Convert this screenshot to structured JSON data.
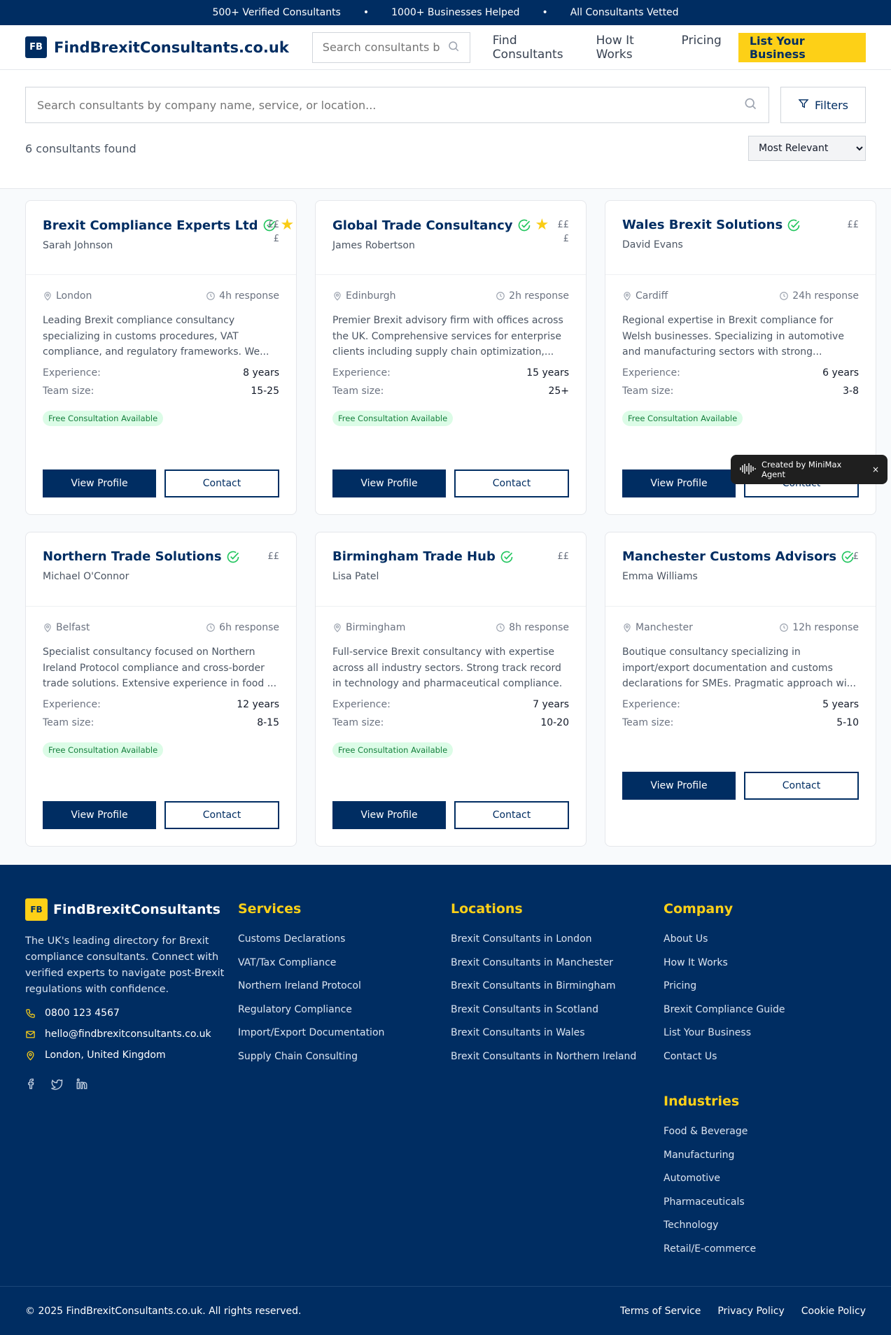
{
  "topbar": {
    "item1": "500+ Verified Consultants",
    "item2": "1000+ Businesses Helped",
    "item3": "All Consultants Vetted",
    "separator": "•"
  },
  "nav": {
    "logo_mark": "FB",
    "logo_text": "FindBrexitConsultants.co.uk",
    "search_placeholder": "Search consultants b",
    "links": [
      "Find Consultants",
      "How It Works",
      "Pricing"
    ],
    "cta": "List Your Business"
  },
  "search": {
    "placeholder": "Search consultants by company name, service, or location...",
    "filters_label": "Filters",
    "results_count": "6 consultants found",
    "sort_selected": "Most Relevant"
  },
  "consultants": [
    {
      "name": "Brexit Compliance Experts Ltd",
      "owner": "Sarah Johnson",
      "featured": true,
      "price": "£££",
      "location": "London",
      "response": "4h response",
      "description": "Leading Brexit compliance consultancy specializing in customs procedures, VAT compliance, and regulatory frameworks. We...",
      "experience": "8 years",
      "team": "15-25",
      "badge": "Free Consultation Available"
    },
    {
      "name": "Global Trade Consultancy",
      "owner": "James Robertson",
      "featured": true,
      "price": "£££",
      "location": "Edinburgh",
      "response": "2h response",
      "description": "Premier Brexit advisory firm with offices across the UK. Comprehensive services for enterprise clients including supply chain optimization,...",
      "experience": "15 years",
      "team": "25+",
      "badge": "Free Consultation Available"
    },
    {
      "name": "Wales Brexit Solutions",
      "owner": "David Evans",
      "featured": false,
      "price": "££",
      "location": "Cardiff",
      "response": "24h response",
      "description": "Regional expertise in Brexit compliance for Welsh businesses. Specializing in automotive and manufacturing sectors with strong...",
      "experience": "6 years",
      "team": "3-8",
      "badge": "Free Consultation Available"
    },
    {
      "name": "Northern Trade Solutions",
      "owner": "Michael O'Connor",
      "featured": false,
      "price": "££",
      "location": "Belfast",
      "response": "6h response",
      "description": "Specialist consultancy focused on Northern Ireland Protocol compliance and cross-border trade solutions. Extensive experience in food ...",
      "experience": "12 years",
      "team": "8-15",
      "badge": "Free Consultation Available"
    },
    {
      "name": "Birmingham Trade Hub",
      "owner": "Lisa Patel",
      "featured": false,
      "price": "££",
      "location": "Birmingham",
      "response": "8h response",
      "description": "Full-service Brexit consultancy with expertise across all industry sectors. Strong track record in technology and pharmaceutical compliance.",
      "experience": "7 years",
      "team": "10-20",
      "badge": "Free Consultation Available"
    },
    {
      "name": "Manchester Customs Advisors",
      "owner": "Emma Williams",
      "featured": false,
      "price": "£",
      "location": "Manchester",
      "response": "12h response",
      "description": "Boutique consultancy specializing in import/export documentation and customs declarations for SMEs. Pragmatic approach wi...",
      "experience": "5 years",
      "team": "5-10",
      "badge": ""
    }
  ],
  "card_labels": {
    "experience": "Experience:",
    "team": "Team size:",
    "view": "View Profile",
    "contact": "Contact"
  },
  "agent_tag": {
    "text": "Created by MiniMax Agent",
    "close": "×"
  },
  "footer": {
    "logo_mark": "FB",
    "logo_text": "FindBrexitConsultants",
    "description": "The UK's leading directory for Brexit compliance consultants. Connect with verified experts to navigate post-Brexit regulations with confidence.",
    "phone": "0800 123 4567",
    "email": "hello@findbrexitconsultants.co.uk",
    "address": "London, United Kingdom",
    "services_title": "Services",
    "services": [
      "Customs Declarations",
      "VAT/Tax Compliance",
      "Northern Ireland Protocol",
      "Regulatory Compliance",
      "Import/Export Documentation",
      "Supply Chain Consulting"
    ],
    "locations_title": "Locations",
    "locations": [
      "Brexit Consultants in London",
      "Brexit Consultants in Manchester",
      "Brexit Consultants in Birmingham",
      "Brexit Consultants in Scotland",
      "Brexit Consultants in Wales",
      "Brexit Consultants in Northern Ireland"
    ],
    "company_title": "Company",
    "company": [
      "About Us",
      "How It Works",
      "Pricing",
      "Brexit Compliance Guide",
      "List Your Business",
      "Contact Us"
    ],
    "industries_title": "Industries",
    "industries": [
      "Food & Beverage",
      "Manufacturing",
      "Automotive",
      "Pharmaceuticals",
      "Technology",
      "Retail/E-commerce"
    ],
    "copyright": "© 2025 FindBrexitConsultants.co.uk. All rights reserved.",
    "legal": [
      "Terms of Service",
      "Privacy Policy",
      "Cookie Policy"
    ]
  },
  "colors": {
    "navy": "#002d62",
    "accent": "#fdd017",
    "verified": "#22c55e"
  }
}
